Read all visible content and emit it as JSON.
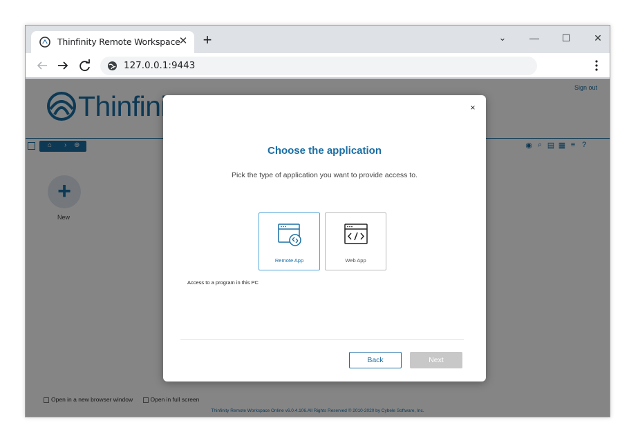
{
  "browser": {
    "tab_title": "Thinfinity Remote Workspace",
    "tab_close": "✕",
    "new_tab": "+",
    "url": "127.0.0.1:9443",
    "window_controls": {
      "minimize": "—",
      "maximize": "☐",
      "close": "✕",
      "dropdown": "⌄"
    }
  },
  "app": {
    "logo_text": "Thinfinit",
    "sign_out": "Sign out",
    "new_label": "New",
    "open_new_window": "Open in a new browser window",
    "open_full_screen": "Open in full screen",
    "footer": "Thinfinity Remote Workspace Online v6.0.4.106.All Rights Reserved © 2010-2020 by Cybele Software, Inc."
  },
  "modal": {
    "close": "×",
    "title": "Choose the application",
    "subtitle": "Pick the type of application you want to provide access to.",
    "options": [
      {
        "label": "Remote App",
        "selected": true,
        "icon": "remote-app-icon"
      },
      {
        "label": "Web App",
        "selected": false,
        "icon": "web-app-icon"
      }
    ],
    "description": "Access to a program in this PC",
    "back_label": "Back",
    "next_label": "Next"
  },
  "colors": {
    "brand": "#1a6ea3",
    "selected_border": "#4ea3d6",
    "disabled": "#c8c8c8"
  }
}
